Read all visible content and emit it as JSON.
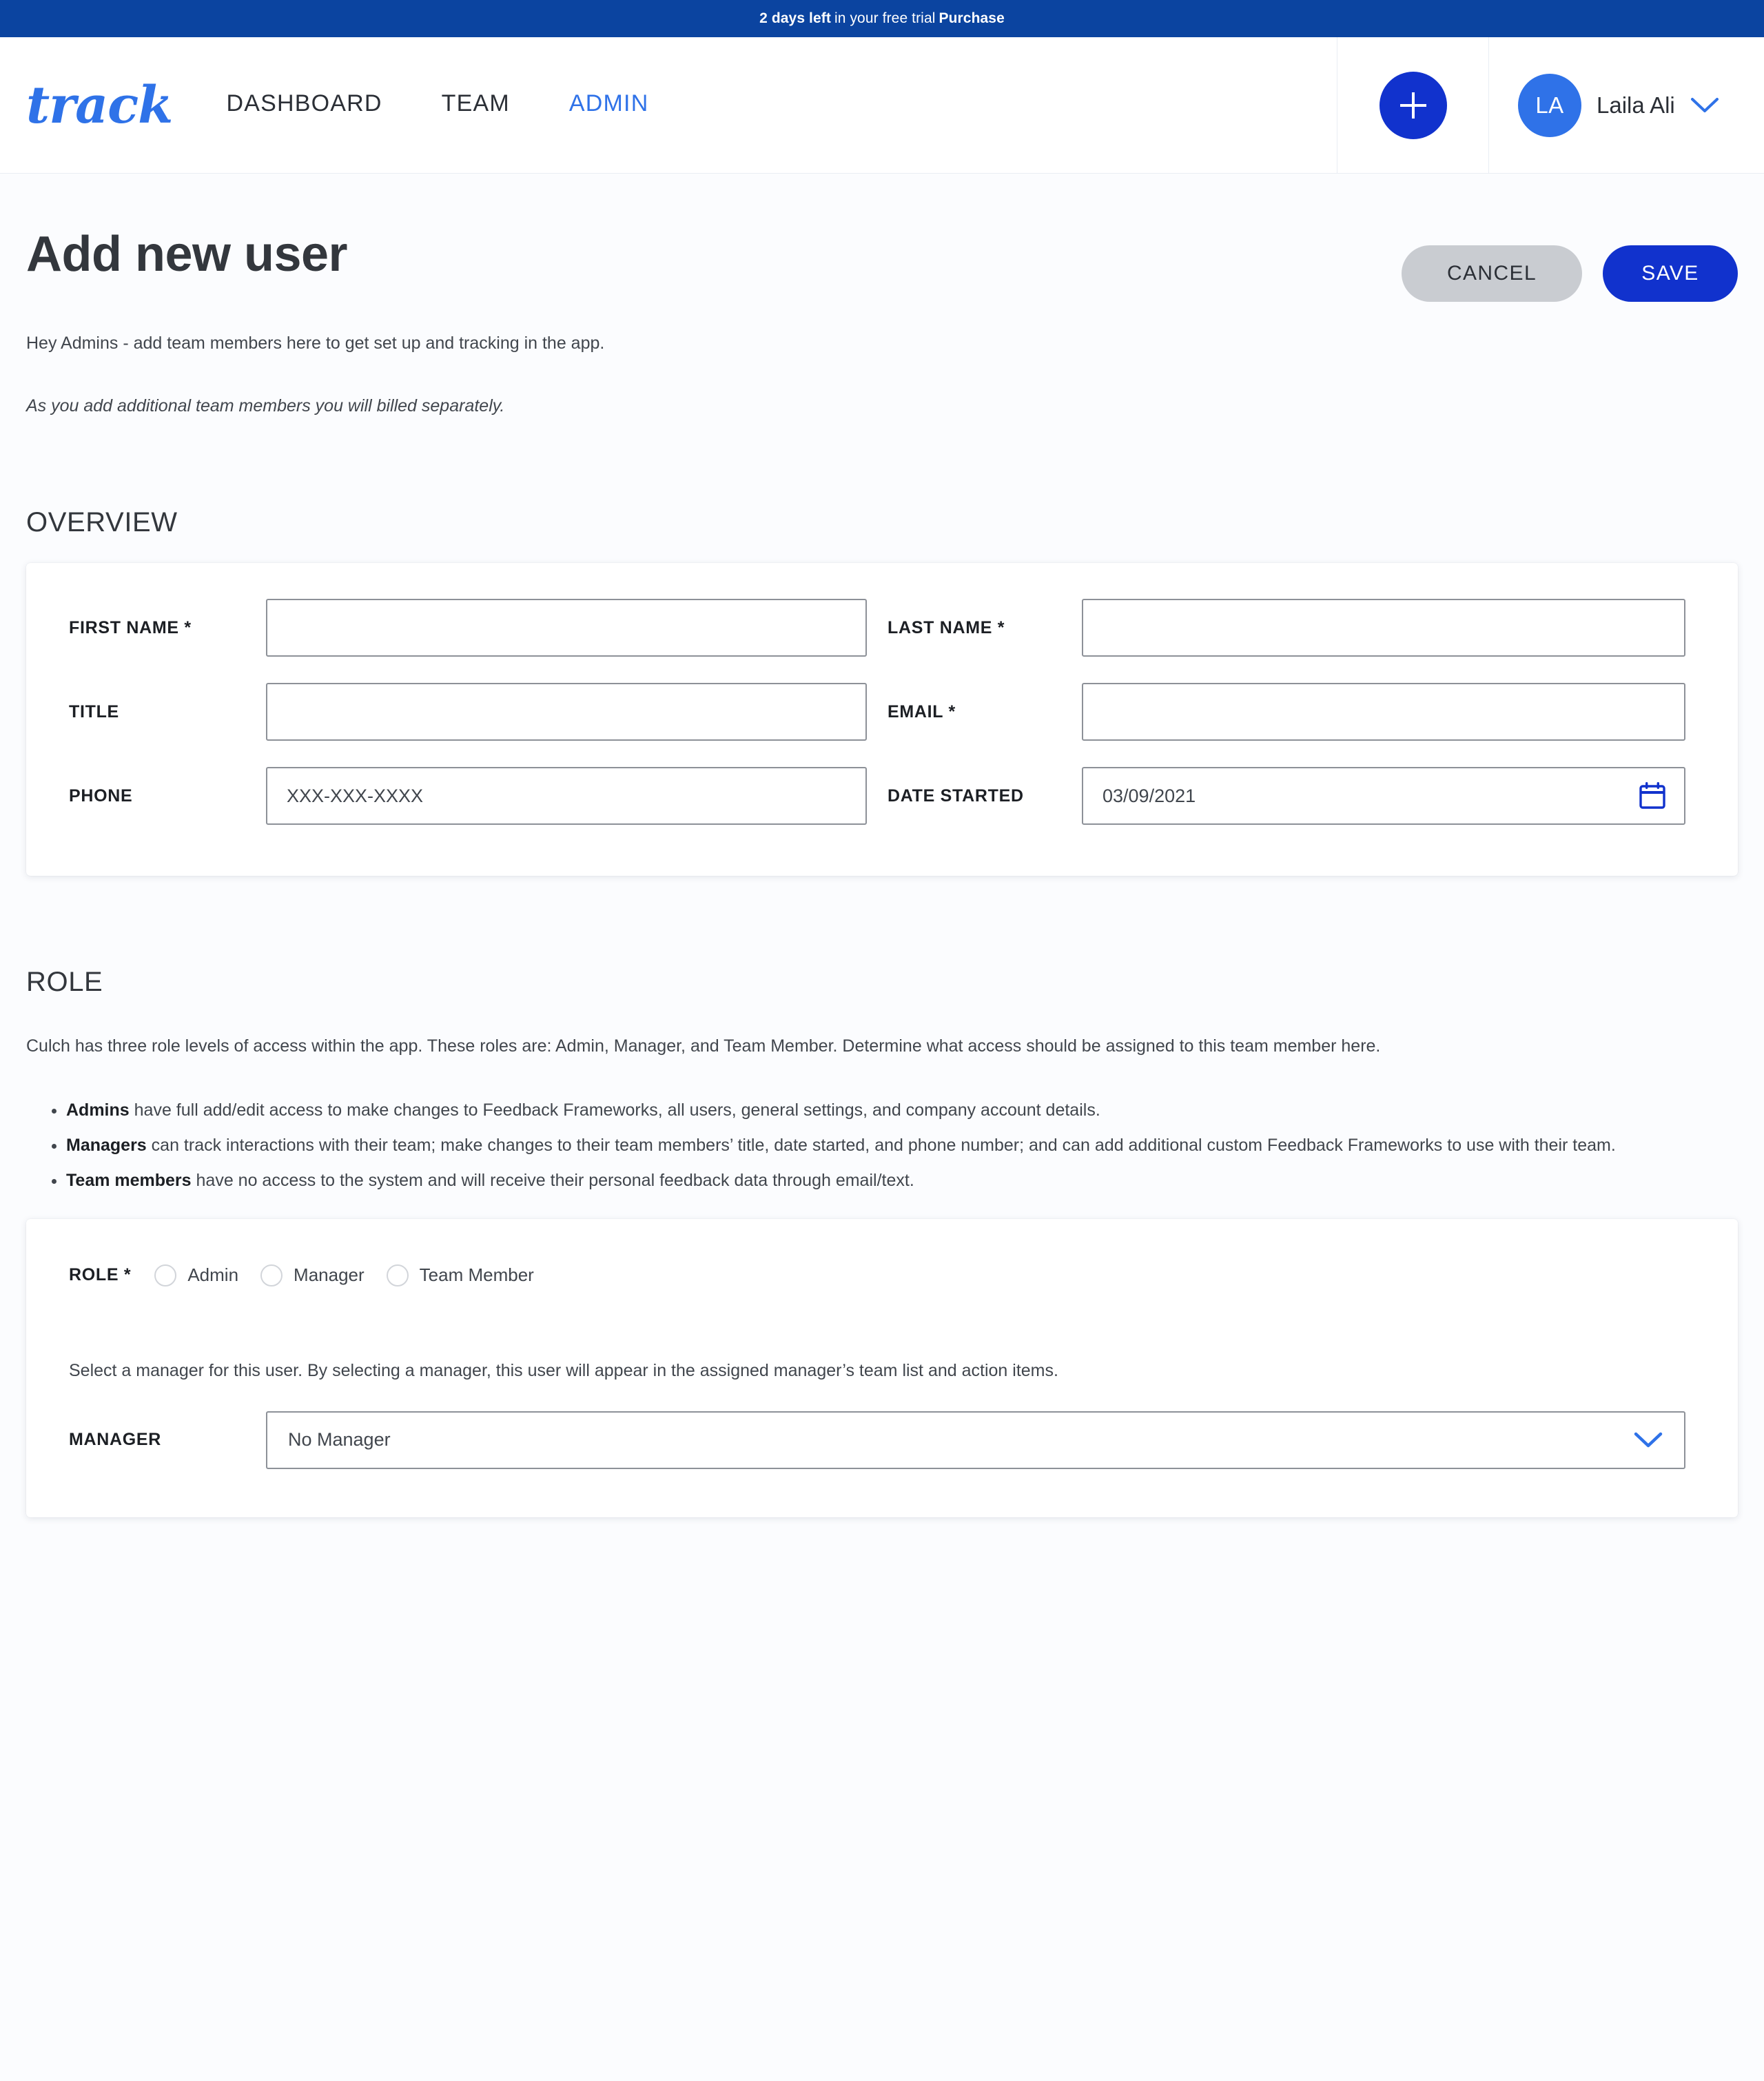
{
  "banner": {
    "days_left": "2 days left",
    "middle": "in your free trial",
    "purchase": "Purchase"
  },
  "nav": {
    "logo": "track",
    "links": [
      {
        "label": "DASHBOARD",
        "active": false
      },
      {
        "label": "TEAM",
        "active": false
      },
      {
        "label": "ADMIN",
        "active": true
      }
    ],
    "add_icon": "plus-icon",
    "user": {
      "initials": "LA",
      "name": "Laila Ali",
      "chevron_icon": "chevron-down-icon"
    }
  },
  "header": {
    "title": "Add new user",
    "cancel_label": "CANCEL",
    "save_label": "SAVE",
    "intro_line_1": "Hey Admins - add team members here to get set up and tracking in the app.",
    "intro_line_2": "As you add additional team members you will billed separately."
  },
  "overview": {
    "section_title": "OVERVIEW",
    "fields": {
      "first_name": {
        "label": "FIRST NAME *",
        "value": "",
        "placeholder": ""
      },
      "last_name": {
        "label": "LAST NAME *",
        "value": "",
        "placeholder": ""
      },
      "title": {
        "label": "TITLE",
        "value": "",
        "placeholder": ""
      },
      "email": {
        "label": "EMAIL *",
        "value": "",
        "placeholder": ""
      },
      "phone": {
        "label": "PHONE",
        "value": "",
        "placeholder": "XXX-XXX-XXXX"
      },
      "date_started": {
        "label": "DATE STARTED",
        "value": "03/09/2021",
        "icon": "calendar-icon"
      }
    }
  },
  "role": {
    "section_title": "ROLE",
    "intro": "Culch has three role levels of access within the app. These roles are: Admin, Manager, and Team Member. Determine what access should be assigned to this team member here.",
    "bullets": [
      {
        "term": "Admins",
        "text": " have full add/edit access to make changes to Feedback Frameworks, all users, general settings, and company account details."
      },
      {
        "term": "Managers",
        "text": " can track interactions with their team; make changes to their team members’ title, date started, and phone number; and can add additional custom Feedback Frameworks to use with their team."
      },
      {
        "term": "Team members",
        "text": " have no access to the system and will receive their personal feedback data through email/text."
      }
    ],
    "role_field_label": "ROLE *",
    "options": [
      "Admin",
      "Manager",
      "Team Member"
    ],
    "selected_option": "",
    "manager_note": "Select a manager for this user. By selecting a manager, this user will appear in the assigned manager’s team list and action items.",
    "manager_label": "MANAGER",
    "manager_value": "No Manager",
    "manager_chevron_icon": "chevron-down-icon"
  },
  "colors": {
    "banner_blue": "#0b44a0",
    "brand_blue": "#2f72e8",
    "primary_blue": "#1132cd",
    "cancel_gray": "#c9ccd1",
    "page_bg": "#fbfcfe",
    "field_border": "#8d9198"
  }
}
